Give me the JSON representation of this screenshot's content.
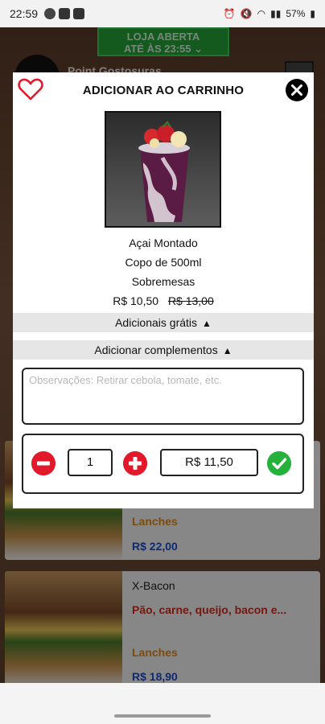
{
  "status_bar": {
    "time": "22:59",
    "battery": "57%"
  },
  "background": {
    "store_status_line1": "LOJA ABERTA",
    "store_status_line2": "ATÉ ÀS 23:55",
    "store_name": "Point Gostosuras",
    "items": [
      {
        "category": "Lanches",
        "price": "R$ 22,00"
      },
      {
        "title": "X-Bacon",
        "description": "Pão, carne, queijo, bacon e...",
        "category": "Lanches",
        "price": "R$ 18,90"
      }
    ]
  },
  "modal": {
    "title": "ADICIONAR AO CARRINHO",
    "product": {
      "name": "Açai Montado",
      "size": "Copo de 500ml",
      "category": "Sobremesas",
      "price": "R$ 10,50",
      "old_price": "R$ 13,00"
    },
    "free_addons_label": "Adicionais grátis",
    "complements_label": "Adicionar complementos",
    "observations_placeholder": "Observações: Retirar cebola, tomate, etc.",
    "quantity": "1",
    "total": "R$ 11,50"
  },
  "colors": {
    "accent_red": "#e2192b",
    "confirm_green": "#26b23a",
    "store_open_green": "#26a53a",
    "price_blue": "#1a4fd0",
    "category_orange": "#e28a1c"
  }
}
